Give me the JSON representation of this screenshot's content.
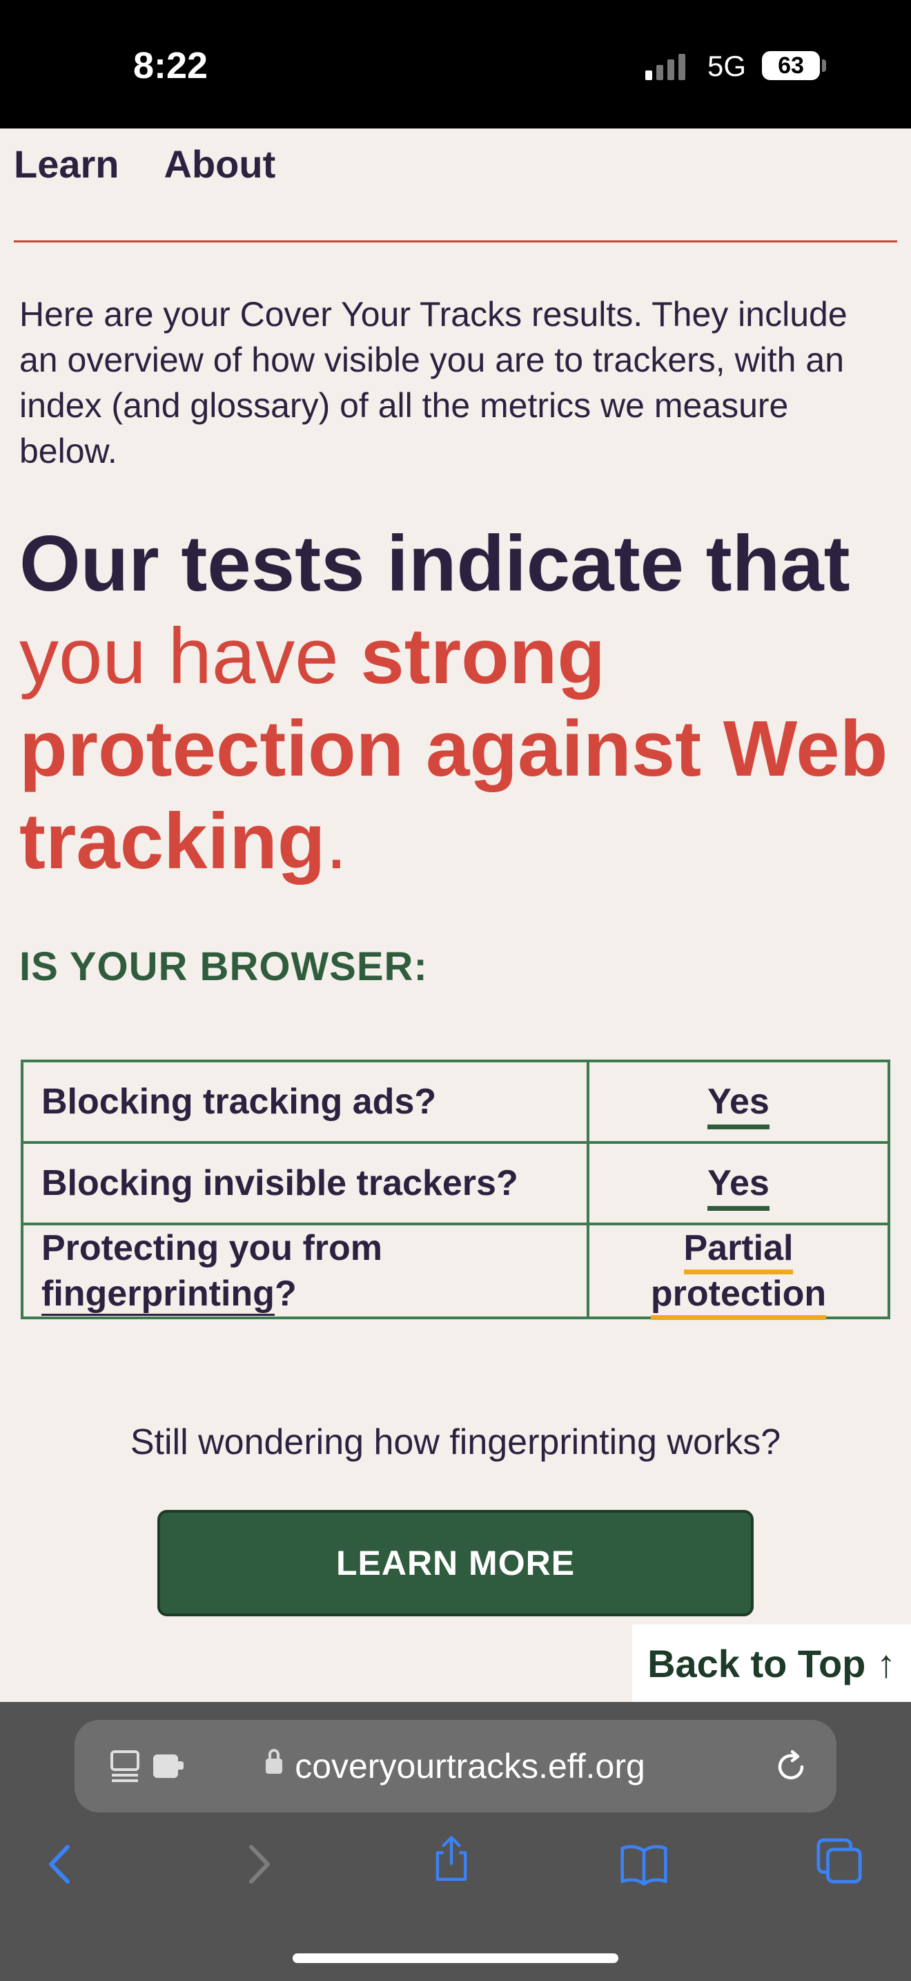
{
  "status": {
    "time": "8:22",
    "network": "5G",
    "battery": "63"
  },
  "nav": {
    "learn": "Learn",
    "about": "About"
  },
  "intro": "Here are your Cover Your Tracks results. They include an overview of how visible you are to trackers, with an index (and glossary) of all the metrics we measure below.",
  "headline": {
    "part1": "Our tests indicate that",
    "part2": "you have ",
    "part3": "strong protection against Web tracking",
    "part4": "."
  },
  "browser_heading": "IS YOUR BROWSER:",
  "results": {
    "row1_question": "Blocking tracking ads?",
    "row1_answer": "Yes",
    "row2_question": "Blocking invisible trackers?",
    "row2_answer": "Yes",
    "row3_question_prefix": "Protecting you from",
    "row3_question_link": "fingerprinting",
    "row3_question_suffix": "?",
    "row3_answer_line1": "Partial",
    "row3_answer_line2": "protection"
  },
  "wonder_text": "Still wondering how fingerprinting works?",
  "learn_more_label": "LEARN MORE",
  "back_to_top_label": "Back to Top ↑",
  "browser": {
    "url": "coveryourtracks.eff.org"
  },
  "colors": {
    "accent_red": "#d4473c",
    "dark_text": "#2b2240",
    "green": "#2f5b3f",
    "gold": "#f0a81e"
  }
}
